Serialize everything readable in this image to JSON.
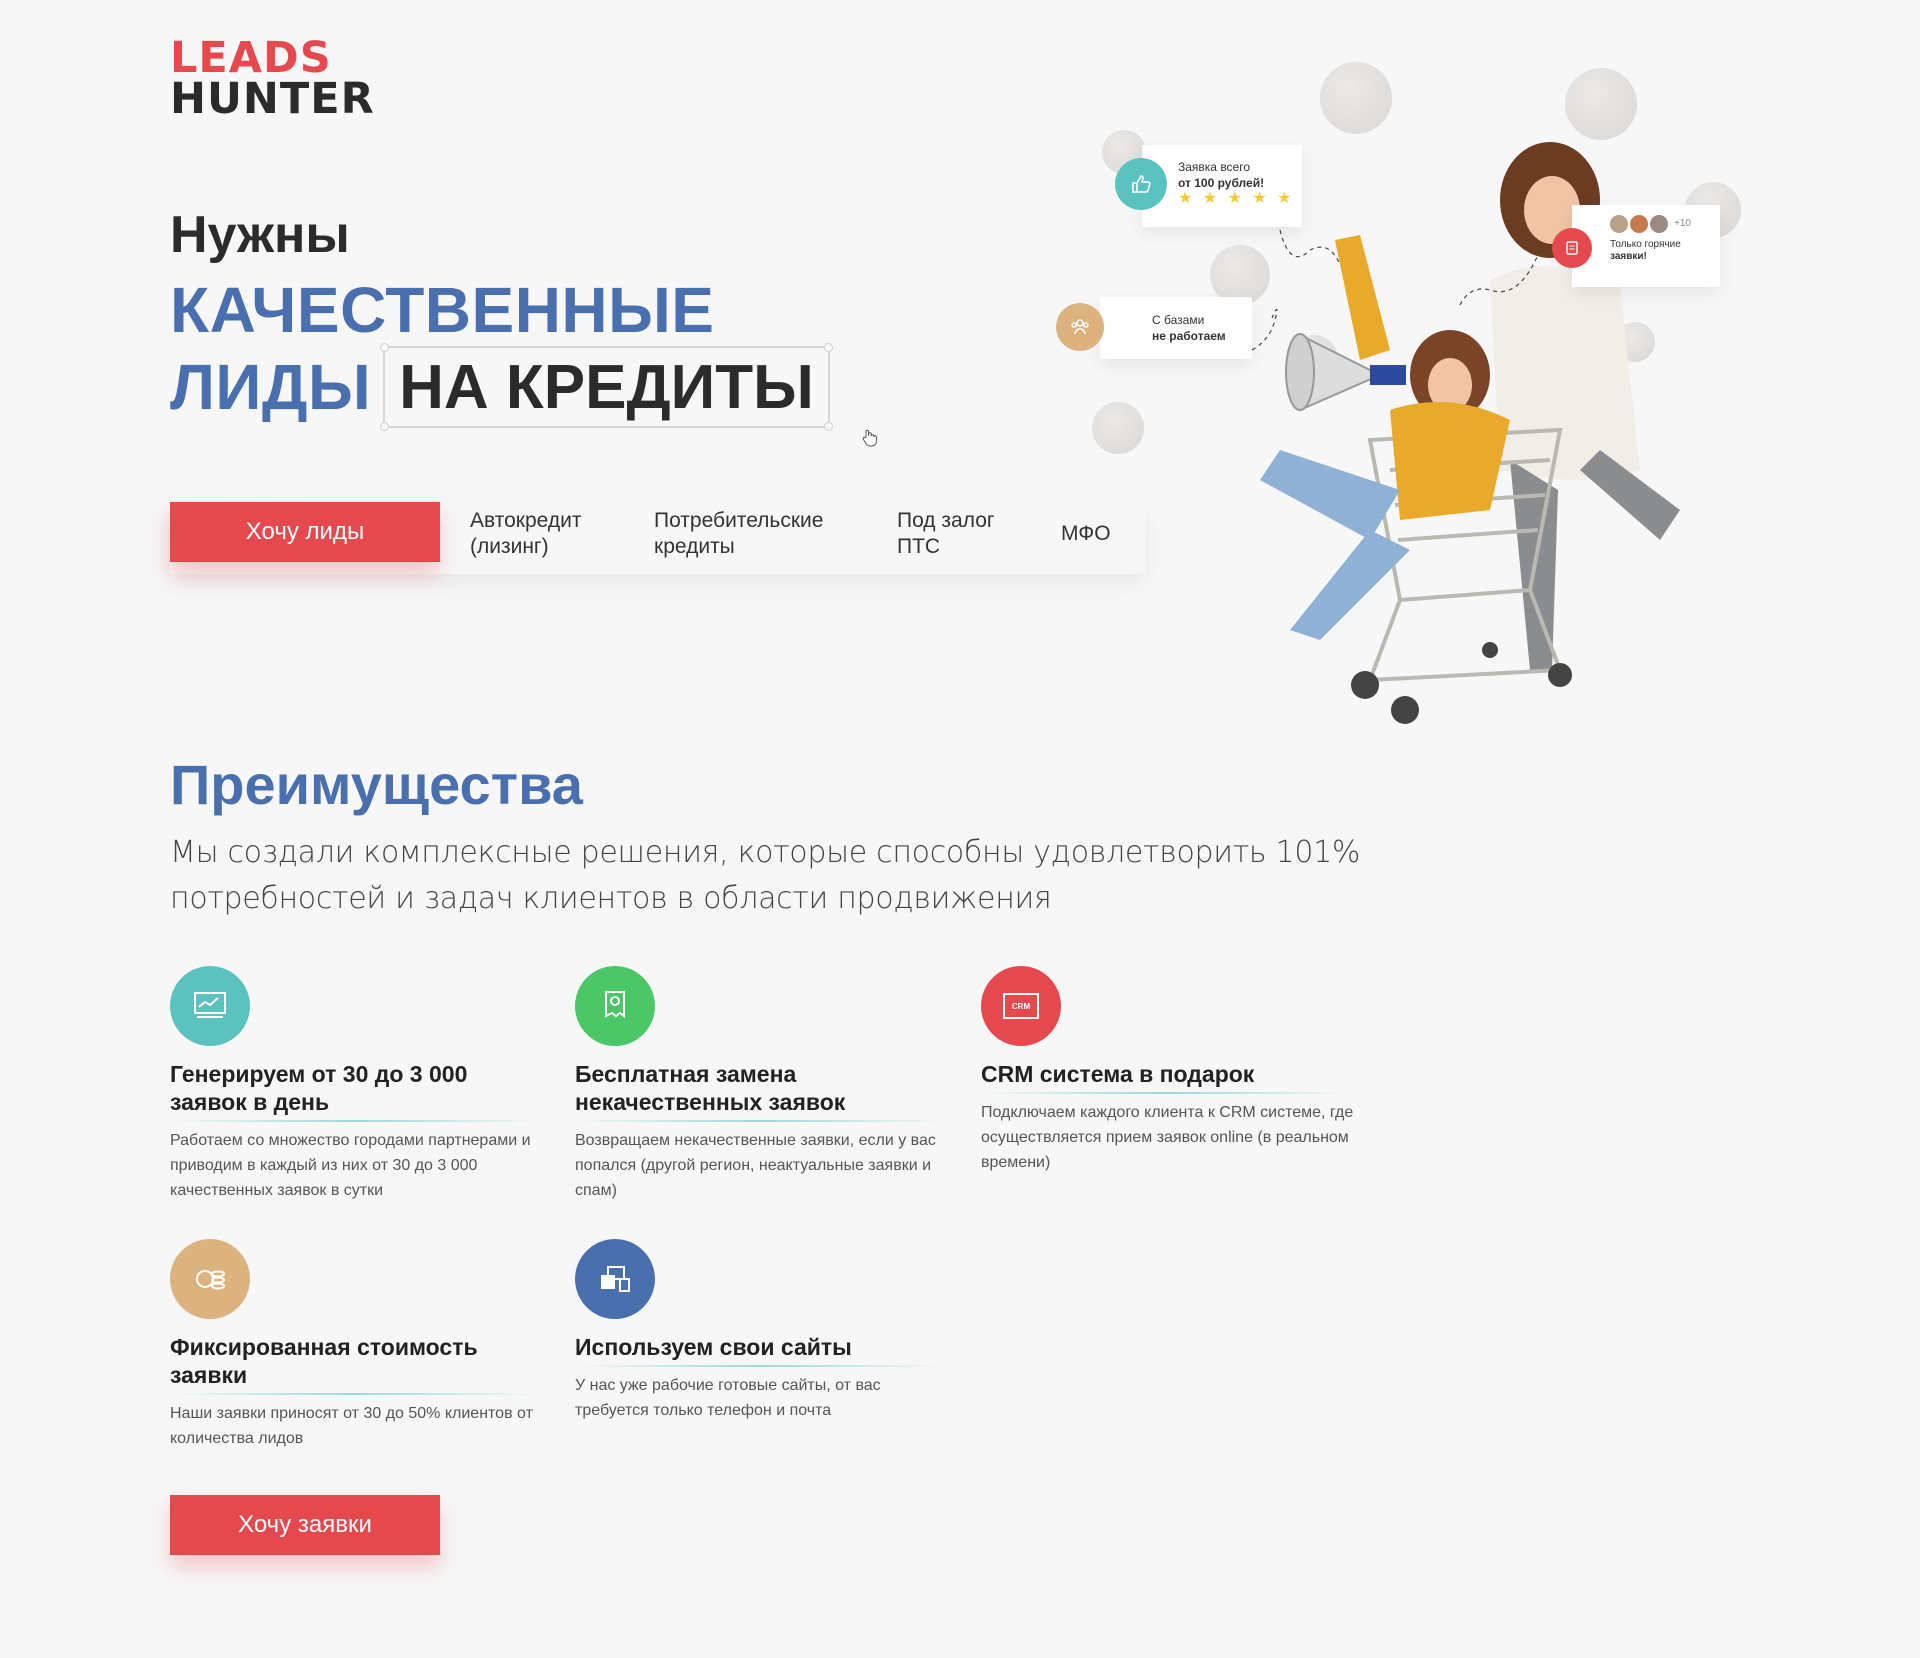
{
  "logo": {
    "line1": "LEADS",
    "line2": "HUNTER"
  },
  "hero": {
    "line1": "Нужны",
    "line2": "КАЧЕСТВЕННЫЕ",
    "line3_blue": "ЛИДЫ",
    "line3_boxed": "НА КРЕДИТЫ"
  },
  "navbar": {
    "cta": "Хочу лиды",
    "items": [
      {
        "label": "Автокредит\n(лизинг)"
      },
      {
        "label": "Потребительские\nкредиты"
      },
      {
        "label": "Под залог\nПТС"
      },
      {
        "label": "МФО"
      }
    ]
  },
  "cards": {
    "price_line1": "Заявка всего",
    "price_line2": "от 100 рублей!",
    "stars": "★ ★ ★ ★ ★",
    "bases_line1": "С базами",
    "bases_line2": "не работаем",
    "hot_count": "+10",
    "hot_line1": "Только горячие",
    "hot_line2": "заявки!"
  },
  "advantages": {
    "title": "Преимущества",
    "subtitle": "Мы создали комплексные решения, которые способны удовлетворить 101% потребностей и задач клиентов в области продвижения",
    "features": [
      {
        "title": "Генерируем от 30 до 3 000 заявок в день",
        "desc": "Работаем со множество городами партнерами и приводим в каждый из них от 30 до 3 000 качественных заявок в сутки",
        "color": "#5cc2c0",
        "icon": "chart-board-icon"
      },
      {
        "title": "Бесплатная замена некачественных заявок",
        "desc": "Возвращаем некачественные заявки, если у вас попался (другой регион, неактуальные заявки и спам)",
        "color": "#4cc767",
        "icon": "certificate-icon"
      },
      {
        "title": "CRM система в подарок",
        "desc": "Подключаем каждого клиента к CRM системе, где осуществляется прием заявок online (в реальном времени)",
        "color": "#e5484d",
        "icon": "crm-icon",
        "icon_text": "CRM"
      },
      {
        "title": "Фиксированная стоимость заявки",
        "desc": "Наши заявки приносят от 30 до 50% клиентов от количества лидов",
        "color": "#dcb27e",
        "icon": "coins-icon"
      },
      {
        "title": "Используем свои сайты",
        "desc": "У нас уже рабочие готовые сайты, от вас требуется только телефон и почта",
        "color": "#4a6fae",
        "icon": "devices-icon"
      }
    ],
    "cta": "Хочу заявки"
  },
  "colors": {
    "brand_red": "#e5484d",
    "brand_blue": "#4a6fae",
    "text_dark": "#2b2b2b"
  }
}
